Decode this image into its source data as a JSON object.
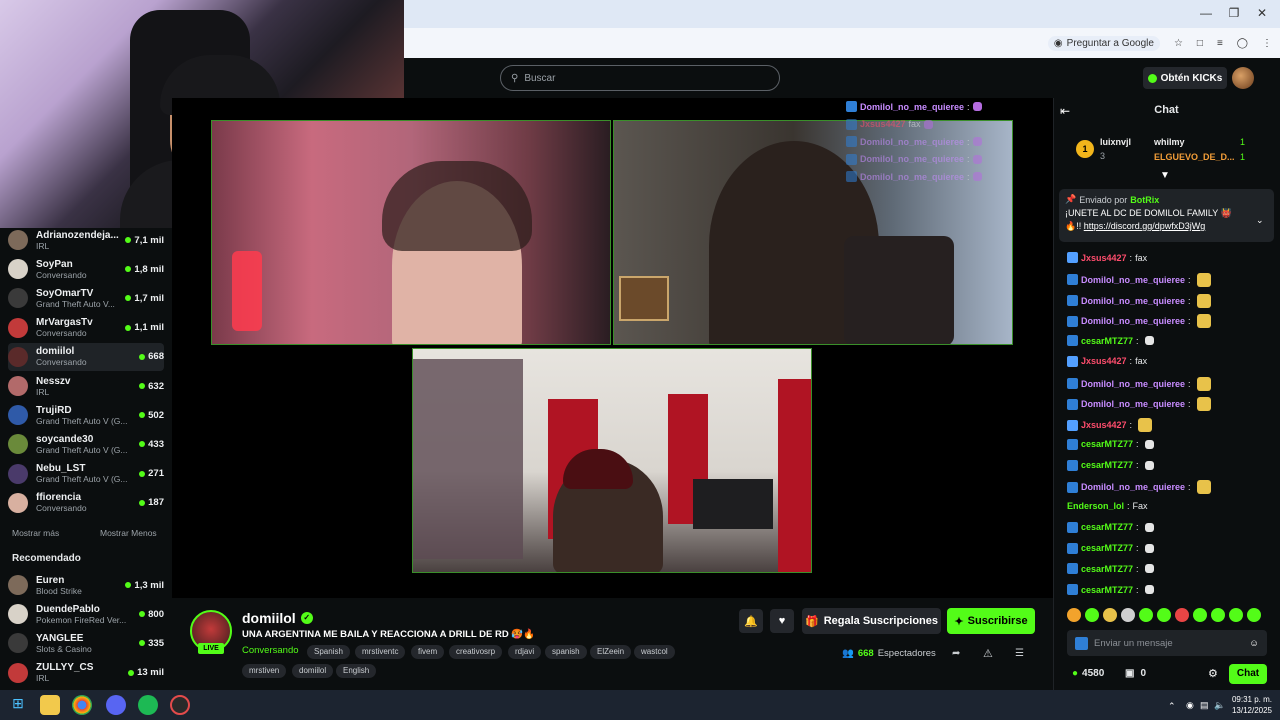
{
  "browser": {
    "ask_google": "Preguntar a Google",
    "window_controls": [
      "minimize-icon",
      "restore-icon",
      "close-icon"
    ]
  },
  "header": {
    "search_placeholder": "Buscar",
    "kicks_label": "Obtén KICKs",
    "brand_color": "#53fc18"
  },
  "sidebar": {
    "channels": [
      {
        "name": "Adrianozendeja...",
        "category": "IRL",
        "viewers": "7,1 mil"
      },
      {
        "name": "SoyPan",
        "category": "Conversando",
        "viewers": "1,8 mil"
      },
      {
        "name": "SoyOmarTV",
        "category": "Grand Theft Auto V...",
        "viewers": "1,7 mil"
      },
      {
        "name": "MrVargasTv",
        "category": "Conversando",
        "viewers": "1,1 mil"
      },
      {
        "name": "domiilol",
        "category": "Conversando",
        "viewers": "668",
        "active": true
      },
      {
        "name": "Nesszv",
        "category": "IRL",
        "viewers": "632"
      },
      {
        "name": "TrujiRD",
        "category": "Grand Theft Auto V (G...",
        "viewers": "502"
      },
      {
        "name": "soycande30",
        "category": "Grand Theft Auto V (G...",
        "viewers": "433"
      },
      {
        "name": "Nebu_LST",
        "category": "Grand Theft Auto V (G...",
        "viewers": "271"
      },
      {
        "name": "ffiorencia",
        "category": "Conversando",
        "viewers": "187"
      }
    ],
    "show_more": "Mostrar más",
    "show_less": "Mostrar Menos",
    "recommended_title": "Recomendado",
    "recommended": [
      {
        "name": "Euren",
        "category": "Blood Strike",
        "viewers": "1,3 mil"
      },
      {
        "name": "DuendePablo",
        "category": "Pokemon FireRed Ver...",
        "viewers": "800"
      },
      {
        "name": "YANGLEE",
        "category": "Slots & Casino",
        "viewers": "335"
      },
      {
        "name": "ZULLYY_CS",
        "category": "IRL",
        "viewers": "13 mil"
      }
    ]
  },
  "video_overlay_chat": [
    {
      "user": "Domilol_no_me_quieree",
      "text": ":"
    },
    {
      "user": "Jxsus4427",
      "text": "fax"
    },
    {
      "user": "Domilol_no_me_quieree",
      "text": ":"
    },
    {
      "user": "Domilol_no_me_quieree",
      "text": ":"
    },
    {
      "user": "Domilol_no_me_quieree",
      "text": ":"
    }
  ],
  "stream": {
    "channel": "domiilol",
    "live": "LIVE",
    "title": "UNA ARGENTINA ME BAILA Y REACCIONA A DRILL DE RD 🥵🔥",
    "category": "Conversando",
    "tags": [
      "Spanish",
      "mrstiventc",
      "fivem",
      "creativosrp",
      "rdjavi",
      "spanish",
      "ElZeein",
      "wastcol",
      "mrstiven",
      "domiilol",
      "English"
    ],
    "gift_label": "Regala Suscripciones",
    "subscribe_label": "Suscribirse",
    "viewers": "668",
    "viewers_label": "Espectadores"
  },
  "chat": {
    "title": "Chat",
    "gifters": [
      {
        "rank": "1",
        "name": "luixnvjl",
        "count": "3"
      },
      {
        "name": "whilmy",
        "count": "1"
      },
      {
        "name": "ELGUEVO_DE_D...",
        "count": "1"
      }
    ],
    "pinned": {
      "by_label": "Enviado por",
      "by_user": "BotRix",
      "text": "¡UNETE AL DC DE DOMILOL FAMILY 👹",
      "text2": "🔥!!",
      "link": "https://discord.gg/dpwfxD3jWg"
    },
    "messages": [
      {
        "user": "Jxsus4427",
        "text": "fax",
        "color": "#ff4d6d"
      },
      {
        "user": "Domilol_no_me_quieree",
        "text": "",
        "color": "#c88cff"
      },
      {
        "user": "Domilol_no_me_quieree",
        "text": "",
        "color": "#c88cff"
      },
      {
        "user": "Domilol_no_me_quieree",
        "text": "",
        "color": "#c88cff"
      },
      {
        "user": "cesarMTZ77",
        "text": "",
        "color": "#53fc18"
      },
      {
        "user": "Jxsus4427",
        "text": "fax",
        "color": "#ff4d6d"
      },
      {
        "user": "Domilol_no_me_quieree",
        "text": "",
        "color": "#c88cff"
      },
      {
        "user": "Domilol_no_me_quieree",
        "text": "",
        "color": "#c88cff"
      },
      {
        "user": "Jxsus4427",
        "text": "",
        "color": "#ff4d6d"
      },
      {
        "user": "cesarMTZ77",
        "text": "",
        "color": "#53fc18"
      },
      {
        "user": "cesarMTZ77",
        "text": "",
        "color": "#53fc18"
      },
      {
        "user": "Domilol_no_me_quieree",
        "text": "",
        "color": "#c88cff"
      },
      {
        "user": "Enderson_lol",
        "text": "Fax",
        "color": "#53fc18"
      },
      {
        "user": "cesarMTZ77",
        "text": "",
        "color": "#53fc18"
      },
      {
        "user": "cesarMTZ77",
        "text": "",
        "color": "#53fc18"
      },
      {
        "user": "cesarMTZ77",
        "text": "",
        "color": "#53fc18"
      },
      {
        "user": "cesarMTZ77",
        "text": "",
        "color": "#53fc18"
      }
    ],
    "input_placeholder": "Enviar un mensaje",
    "kicks_balance": "4580",
    "subs_balance": "0",
    "send_label": "Chat"
  },
  "taskbar": {
    "time": "09:31 p. m.",
    "date": "13/12/2025"
  }
}
